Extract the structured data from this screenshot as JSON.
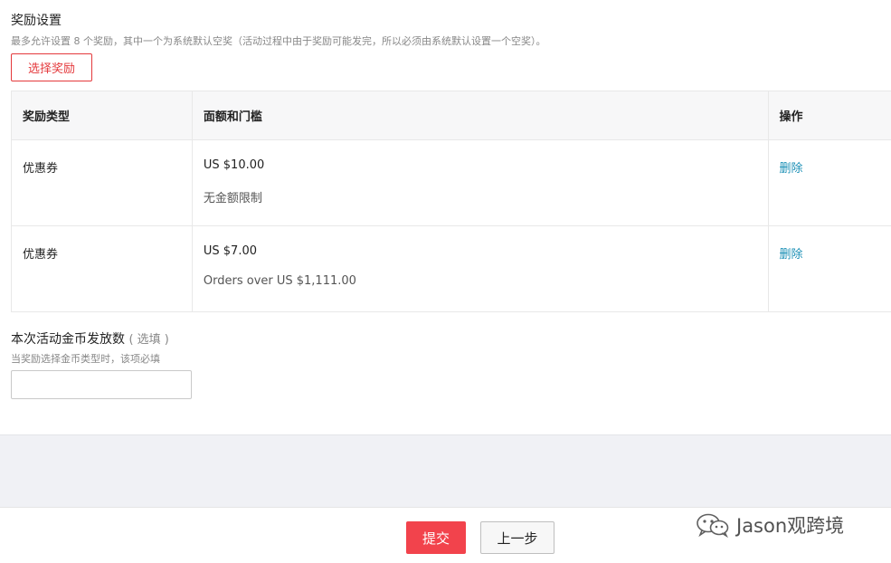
{
  "reward_settings": {
    "title": "奖励设置",
    "hint": "最多允许设置 8 个奖励，其中一个为系统默认空奖（活动过程中由于奖励可能发完，所以必须由系统默认设置一个空奖）。",
    "select_button": "选择奖励"
  },
  "table": {
    "headers": [
      "奖励类型",
      "面额和门槛",
      "操作"
    ],
    "rows": [
      {
        "type": "优惠券",
        "amount": "US $10.00",
        "threshold": "无金额限制",
        "action": "删除"
      },
      {
        "type": "优惠券",
        "amount": "US $7.00",
        "threshold": "Orders over US $1,111.00",
        "action": "删除"
      }
    ]
  },
  "coins": {
    "label": "本次活动金币发放数",
    "optional": "( 选填 )",
    "hint": "当奖励选择金币类型时，该项必填",
    "value": "",
    "placeholder": ""
  },
  "footer": {
    "submit": "提交",
    "prev": "上一步"
  },
  "watermark": {
    "text": "Jason观跨境",
    "icon": "wechat-icon"
  }
}
